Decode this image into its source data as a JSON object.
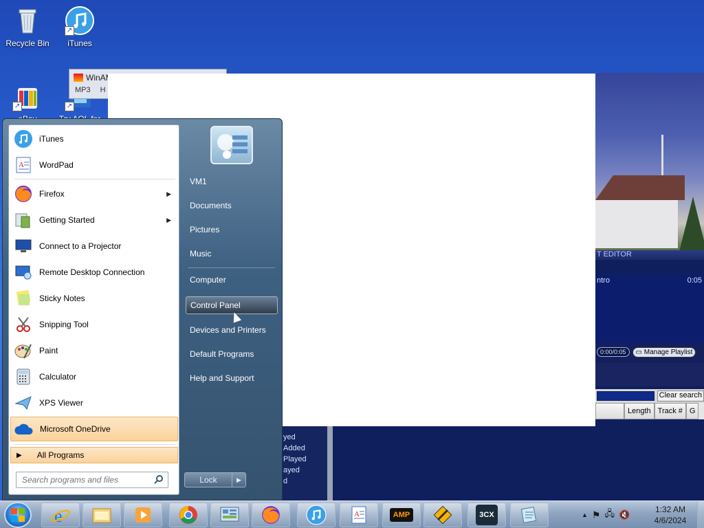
{
  "desktop": {
    "icons": [
      {
        "label": "Recycle Bin",
        "icon": "recycle-bin-icon"
      },
      {
        "label": "iTunes",
        "icon": "itunes-icon"
      },
      {
        "label": "eBay",
        "icon": "ebay-icon"
      },
      {
        "label": "Try AOL for",
        "icon": "aol-icon"
      }
    ]
  },
  "winamp_mini": {
    "title": "WinAM",
    "menu": [
      "MP3",
      "H"
    ]
  },
  "winamp": {
    "playlist_title": "T EDITOR",
    "track": {
      "name": "ntro",
      "time": "0:05"
    },
    "time_display": "0:00/0:05",
    "manage_playlist": "Manage Playlist",
    "clear_search": "Clear search",
    "columns": [
      "Length",
      "Track #",
      "G"
    ],
    "left_items": [
      "yed",
      "Added",
      "Played",
      "ayed",
      "d"
    ]
  },
  "start_menu": {
    "programs": [
      {
        "label": "iTunes",
        "icon": "itunes-icon",
        "submenu": false
      },
      {
        "label": "WordPad",
        "icon": "wordpad-icon",
        "submenu": false
      },
      {
        "label": "Firefox",
        "icon": "firefox-icon",
        "submenu": true
      },
      {
        "label": "Getting Started",
        "icon": "getting-started-icon",
        "submenu": true
      },
      {
        "label": "Connect to a Projector",
        "icon": "projector-icon",
        "submenu": false
      },
      {
        "label": "Remote Desktop Connection",
        "icon": "remote-desktop-icon",
        "submenu": false
      },
      {
        "label": "Sticky Notes",
        "icon": "sticky-notes-icon",
        "submenu": false
      },
      {
        "label": "Snipping Tool",
        "icon": "snipping-tool-icon",
        "submenu": false
      },
      {
        "label": "Paint",
        "icon": "paint-icon",
        "submenu": false
      },
      {
        "label": "Calculator",
        "icon": "calculator-icon",
        "submenu": false
      },
      {
        "label": "XPS Viewer",
        "icon": "xps-viewer-icon",
        "submenu": false
      },
      {
        "label": "Microsoft OneDrive",
        "icon": "onedrive-icon",
        "submenu": false
      }
    ],
    "all_programs": "All Programs",
    "search_placeholder": "Search programs and files",
    "right_items": [
      "VM1",
      "Documents",
      "Pictures",
      "Music",
      "Computer",
      "Control Panel",
      "Devices and Printers",
      "Default Programs",
      "Help and Support"
    ],
    "highlighted_right": "Control Panel",
    "lock": "Lock"
  },
  "taskbar": {
    "apps": [
      "internet-explorer-icon",
      "file-explorer-icon",
      "media-player-icon",
      "chrome-icon",
      "control-panel-icon",
      "firefox-icon",
      "itunes-icon",
      "wordpad-icon",
      "winamp-icon",
      "tool-icon",
      "3cx-icon",
      "notepad-icon"
    ],
    "amp_label": "AMP",
    "threecx_label": "3CX",
    "time": "1:32 AM",
    "date": "4/6/2024"
  }
}
